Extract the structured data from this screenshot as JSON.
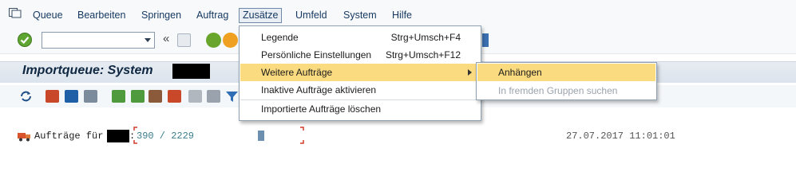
{
  "menubar": {
    "items": [
      {
        "label": "Queue"
      },
      {
        "label": "Bearbeiten"
      },
      {
        "label": "Springen"
      },
      {
        "label": "Auftrag"
      },
      {
        "label": "Zusätze"
      },
      {
        "label": "Umfeld"
      },
      {
        "label": "System"
      },
      {
        "label": "Hilfe"
      }
    ]
  },
  "toolbar": {
    "command_field_value": "",
    "back_glyph": "«"
  },
  "title": {
    "text": "Importqueue: System"
  },
  "dropdown": {
    "items": [
      {
        "label": "Legende",
        "accel": "Strg+Umsch+F4"
      },
      {
        "label": "Persönliche Einstellungen",
        "accel": "Strg+Umsch+F12"
      },
      {
        "label": "Weitere Aufträge",
        "accel": ""
      },
      {
        "label": "Inaktive Aufträge aktivieren",
        "accel": ""
      },
      {
        "label": "Importierte Aufträge löschen",
        "accel": ""
      }
    ]
  },
  "submenu": {
    "items": [
      {
        "label": "Anhängen",
        "enabled": true
      },
      {
        "label": "In fremden Gruppen suchen",
        "enabled": false
      }
    ]
  },
  "status": {
    "label": "Aufträge für",
    "count": "390 / 2229",
    "datetime": "27.07.2017 11:01:01"
  },
  "colors": {
    "highlight": "#fbdb7f",
    "menu_text": "#14375f",
    "count_text": "#3a7d8c"
  }
}
